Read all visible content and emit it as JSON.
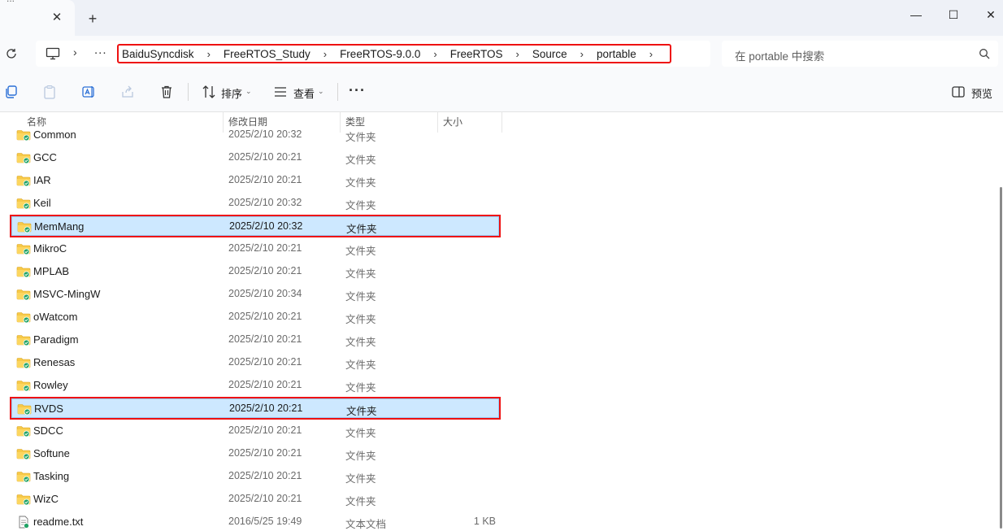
{
  "window": {
    "tab_title": "...",
    "new_tab": "+",
    "tab_close": "✕",
    "minimize": "—",
    "maximize": "☐",
    "close": "✕"
  },
  "address": {
    "more": "...",
    "breadcrumbs": [
      "BaiduSyncdisk",
      "FreeRTOS_Study",
      "FreeRTOS-9.0.0",
      "FreeRTOS",
      "Source",
      "portable"
    ],
    "search_placeholder": "在 portable 中搜索"
  },
  "toolbar": {
    "sort_label": "排序",
    "view_label": "查看",
    "more": "···",
    "preview_label": "预览"
  },
  "columns": {
    "name": "名称",
    "modified": "修改日期",
    "type": "类型",
    "size": "大小"
  },
  "files": [
    {
      "name": "Common",
      "modified": "2025/2/10 20:32",
      "type": "文件夹",
      "size": "",
      "kind": "folder",
      "selected": false
    },
    {
      "name": "GCC",
      "modified": "2025/2/10 20:21",
      "type": "文件夹",
      "size": "",
      "kind": "folder",
      "selected": false
    },
    {
      "name": "IAR",
      "modified": "2025/2/10 20:21",
      "type": "文件夹",
      "size": "",
      "kind": "folder",
      "selected": false
    },
    {
      "name": "Keil",
      "modified": "2025/2/10 20:32",
      "type": "文件夹",
      "size": "",
      "kind": "folder",
      "selected": false
    },
    {
      "name": "MemMang",
      "modified": "2025/2/10 20:32",
      "type": "文件夹",
      "size": "",
      "kind": "folder",
      "selected": true
    },
    {
      "name": "MikroC",
      "modified": "2025/2/10 20:21",
      "type": "文件夹",
      "size": "",
      "kind": "folder",
      "selected": false
    },
    {
      "name": "MPLAB",
      "modified": "2025/2/10 20:21",
      "type": "文件夹",
      "size": "",
      "kind": "folder",
      "selected": false
    },
    {
      "name": "MSVC-MingW",
      "modified": "2025/2/10 20:34",
      "type": "文件夹",
      "size": "",
      "kind": "folder",
      "selected": false
    },
    {
      "name": "oWatcom",
      "modified": "2025/2/10 20:21",
      "type": "文件夹",
      "size": "",
      "kind": "folder",
      "selected": false
    },
    {
      "name": "Paradigm",
      "modified": "2025/2/10 20:21",
      "type": "文件夹",
      "size": "",
      "kind": "folder",
      "selected": false
    },
    {
      "name": "Renesas",
      "modified": "2025/2/10 20:21",
      "type": "文件夹",
      "size": "",
      "kind": "folder",
      "selected": false
    },
    {
      "name": "Rowley",
      "modified": "2025/2/10 20:21",
      "type": "文件夹",
      "size": "",
      "kind": "folder",
      "selected": false
    },
    {
      "name": "RVDS",
      "modified": "2025/2/10 20:21",
      "type": "文件夹",
      "size": "",
      "kind": "folder",
      "selected": true
    },
    {
      "name": "SDCC",
      "modified": "2025/2/10 20:21",
      "type": "文件夹",
      "size": "",
      "kind": "folder",
      "selected": false
    },
    {
      "name": "Softune",
      "modified": "2025/2/10 20:21",
      "type": "文件夹",
      "size": "",
      "kind": "folder",
      "selected": false
    },
    {
      "name": "Tasking",
      "modified": "2025/2/10 20:21",
      "type": "文件夹",
      "size": "",
      "kind": "folder",
      "selected": false
    },
    {
      "name": "WizC",
      "modified": "2025/2/10 20:21",
      "type": "文件夹",
      "size": "",
      "kind": "folder",
      "selected": false
    },
    {
      "name": "readme.txt",
      "modified": "2016/5/25 19:49",
      "type": "文本文档",
      "size": "1 KB",
      "kind": "text",
      "selected": false
    }
  ],
  "colors": {
    "selection_bg": "#cde8ff",
    "highlight_border": "#ee1111",
    "folder_yellow": "#f7c948",
    "sync_green": "#21a366"
  }
}
